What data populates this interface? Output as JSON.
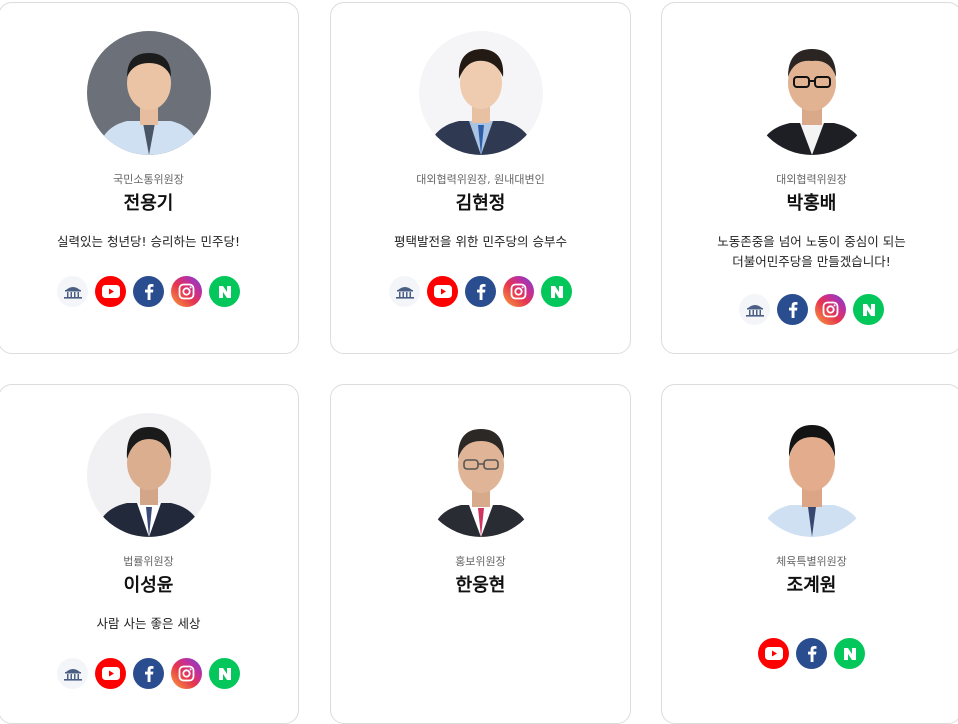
{
  "members": [
    {
      "role": "국민소통위원장",
      "name": "전용기",
      "slogan": [
        "실력있는 청년당! 승리하는 민주당!"
      ],
      "socials": [
        "assembly-icon",
        "youtube-icon",
        "facebook-icon",
        "instagram-icon",
        "naver-icon"
      ]
    },
    {
      "role": "대외협력위원장, 원내대변인",
      "name": "김현정",
      "slogan": [
        "평택발전을 위한 민주당의 승부수"
      ],
      "socials": [
        "assembly-icon",
        "youtube-icon",
        "facebook-icon",
        "instagram-icon",
        "naver-icon"
      ]
    },
    {
      "role": "대외협력위원장",
      "name": "박홍배",
      "slogan": [
        "노동존중을 넘어 노동이 중심이 되는",
        "더불어민주당을 만들겠습니다!"
      ],
      "socials": [
        "assembly-icon",
        "facebook-icon",
        "instagram-icon",
        "naver-icon"
      ]
    },
    {
      "role": "법률위원장",
      "name": "이성윤",
      "slogan": [
        "사람 사는 좋은 세상"
      ],
      "socials": [
        "assembly-icon",
        "youtube-icon",
        "facebook-icon",
        "instagram-icon",
        "naver-icon"
      ]
    },
    {
      "role": "홍보위원장",
      "name": "한웅현",
      "slogan": [],
      "socials": []
    },
    {
      "role": "체육특별위원장",
      "name": "조계원",
      "slogan": [],
      "socials": [
        "youtube-icon",
        "facebook-icon",
        "naver-icon"
      ]
    }
  ],
  "colors": {
    "youtube": "#ff0000",
    "facebook": "#2a4d8f",
    "naver": "#03c75a",
    "border": "#dcdcdc"
  }
}
